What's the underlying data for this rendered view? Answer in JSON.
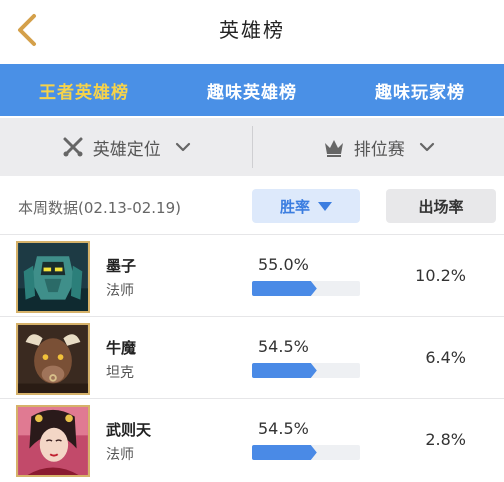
{
  "header": {
    "title": "英雄榜",
    "back_icon": "chevron-left-icon",
    "accent": "#d4a04a"
  },
  "tabs": [
    {
      "label": "王者英雄榜",
      "active": true
    },
    {
      "label": "趣味英雄榜",
      "active": false
    },
    {
      "label": "趣味玩家榜",
      "active": false
    }
  ],
  "filters": [
    {
      "label": "英雄定位",
      "icon": "crossed-swords-icon"
    },
    {
      "label": "排位赛",
      "icon": "crown-icon"
    }
  ],
  "sortbar": {
    "week_label": "本周数据(02.13-02.19)",
    "win_label": "胜率",
    "appear_label": "出场率"
  },
  "heroes": [
    {
      "name": "墨子",
      "role": "法师",
      "win_rate": "55.0%",
      "win_fraction": 0.6,
      "appear_rate": "10.2%"
    },
    {
      "name": "牛魔",
      "role": "坦克",
      "win_rate": "54.5%",
      "win_fraction": 0.6,
      "appear_rate": "6.4%"
    },
    {
      "name": "武则天",
      "role": "法师",
      "win_rate": "54.5%",
      "win_fraction": 0.6,
      "appear_rate": "2.8%"
    }
  ],
  "colors": {
    "tab_bar": "#4a90e6",
    "active_tab": "#f6d34a",
    "bar_fill": "#4a8ae6"
  }
}
